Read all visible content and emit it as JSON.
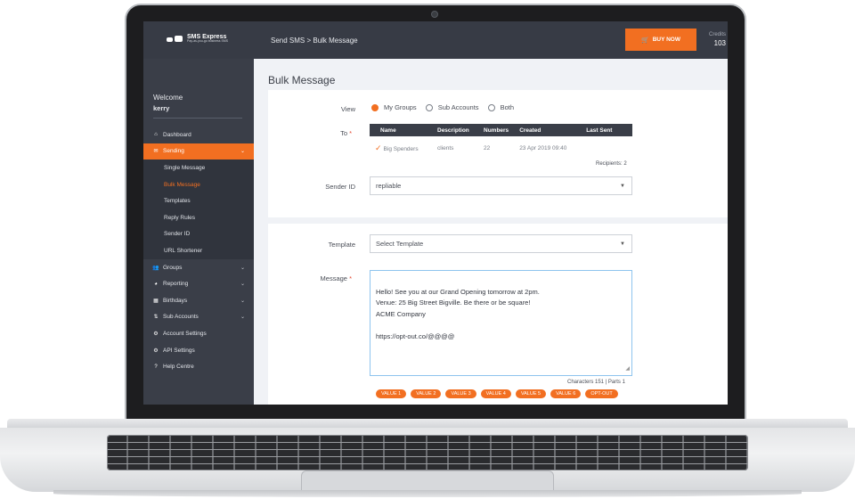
{
  "app": {
    "logo_name": "SMS Express",
    "logo_tagline": "Pay-as-you-go business SMS"
  },
  "header": {
    "breadcrumb": "Send SMS > Bulk Message",
    "buy_label": "BUY NOW",
    "credits_label": "Credits",
    "credits_value": "103"
  },
  "sidebar": {
    "welcome": "Welcome",
    "user": "kerry",
    "items": [
      {
        "label": "Dashboard",
        "icon": "home-icon"
      },
      {
        "label": "Sending",
        "icon": "envelope-icon"
      },
      {
        "label": "Groups",
        "icon": "users-icon"
      },
      {
        "label": "Reporting",
        "icon": "pie-chart-icon"
      },
      {
        "label": "Birthdays",
        "icon": "calendar-icon"
      },
      {
        "label": "Sub Accounts",
        "icon": "sub-accounts-icon"
      },
      {
        "label": "Account Settings",
        "icon": "cogs-icon"
      },
      {
        "label": "API Settings",
        "icon": "api-icon"
      },
      {
        "label": "Help Centre",
        "icon": "help-icon"
      }
    ],
    "sending_sub": [
      "Single Message",
      "Bulk Message",
      "Templates",
      "Reply Rules",
      "Sender ID",
      "URL Shortener"
    ]
  },
  "main": {
    "title": "Bulk Message",
    "view_label": "View",
    "view_options": [
      "My Groups",
      "Sub Accounts",
      "Both"
    ],
    "view_selected": "My Groups",
    "to_label": "To",
    "required_mark": "*",
    "table": {
      "columns": [
        "Name",
        "Description",
        "Numbers",
        "Created",
        "Last Sent"
      ],
      "rows": [
        [
          "Big Spenders",
          "clients",
          "22",
          "23 Apr 2019 09:40",
          ""
        ]
      ]
    },
    "recipients": "Recipients: 2",
    "sender_label": "Sender ID",
    "sender_value": "repliable",
    "template_label": "Template",
    "template_placeholder": "Select Template",
    "message_label": "Message",
    "message_text": "Hello! See you at our Grand Opening tomorrow at 2pm.\nVenue: 25 Big Street Bigville. Be there or be square!\nACME Company\n\nhttps://opt-out.co/@@@@",
    "char_count": "Characters 151 | Parts 1",
    "tags": [
      "VALUE 1",
      "VALUE 2",
      "VALUE 3",
      "VALUE 4",
      "VALUE 5",
      "VALUE 6",
      "OPT-OUT"
    ]
  },
  "colors": {
    "accent": "#f26f21",
    "sidebar": "#3a3e48",
    "topbar": "#373b45"
  }
}
